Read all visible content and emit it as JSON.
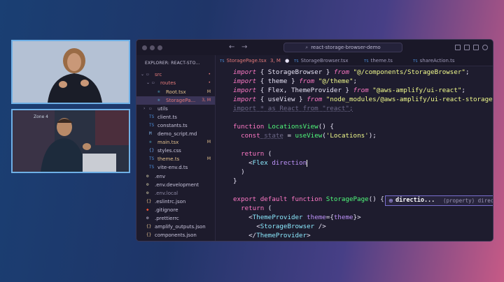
{
  "webcams": {
    "top_label": "",
    "bottom_label": "Zone 4"
  },
  "window": {
    "search_text": "react-storage-browser-demo",
    "back": "←",
    "forward": "→"
  },
  "explorer": {
    "header": "EXPLORER: REACT-STO...",
    "items": [
      {
        "label": "src",
        "icon": "folder-icon",
        "chev": "⌄",
        "badge": "•",
        "color": "#e37979"
      },
      {
        "label": "routes",
        "icon": "folder-icon",
        "chev": "⌄",
        "badge": "•",
        "color": "#e37979"
      },
      {
        "label": "Root.tsx",
        "icon": "tsx-file-icon",
        "badge": "M",
        "color": "#e2c08d"
      },
      {
        "label": "StoragePa...",
        "icon": "tsx-file-icon",
        "badge": "3, M",
        "color": "#e37979"
      },
      {
        "label": "utils",
        "icon": "folder-icon",
        "chev": "›",
        "badge": "",
        "color": "#c9c5dc"
      },
      {
        "label": "client.ts",
        "icon": "ts-file-icon",
        "badge": "",
        "color": "#c9c5dc"
      },
      {
        "label": "constants.ts",
        "icon": "ts-file-icon",
        "badge": "",
        "color": "#c9c5dc"
      },
      {
        "label": "demo_script.md",
        "icon": "md-file-icon",
        "badge": "",
        "color": "#c9c5dc"
      },
      {
        "label": "main.tsx",
        "icon": "tsx-file-icon",
        "badge": "M",
        "color": "#e2c08d"
      },
      {
        "label": "styles.css",
        "icon": "css-file-icon",
        "badge": "",
        "color": "#c9c5dc"
      },
      {
        "label": "theme.ts",
        "icon": "ts-file-icon",
        "badge": "M",
        "color": "#e2c08d"
      },
      {
        "label": "vite-env.d.ts",
        "icon": "ts-file-icon",
        "badge": "",
        "color": "#c9c5dc"
      },
      {
        "label": ".env",
        "icon": "env-file-icon",
        "badge": "",
        "color": "#c9c5dc"
      },
      {
        "label": ".env.development",
        "icon": "env-file-icon",
        "badge": "",
        "color": "#c9c5dc"
      },
      {
        "label": ".env.local",
        "icon": "env-file-icon",
        "badge": "",
        "color": "#8e8aa6"
      },
      {
        "label": ".eslintrc.json",
        "icon": "json-file-icon",
        "badge": "",
        "color": "#c9c5dc"
      },
      {
        "label": ".gitignore",
        "icon": "git-file-icon",
        "badge": "",
        "color": "#c9c5dc"
      },
      {
        "label": ".prettierrc",
        "icon": "config-file-icon",
        "badge": "",
        "color": "#c9c5dc"
      },
      {
        "label": "amplify_outputs.json",
        "icon": "json-file-icon",
        "badge": "",
        "color": "#c9c5dc"
      },
      {
        "label": "components.json",
        "icon": "json-file-icon",
        "badge": "",
        "color": "#c9c5dc"
      }
    ]
  },
  "tabs": [
    {
      "label": "StoragePage.tsx",
      "extra": "3, M",
      "marker": "●"
    },
    {
      "label": "StorageBrowser.tsx",
      "extra": "",
      "marker": ""
    },
    {
      "label": "theme.ts",
      "extra": "",
      "marker": ""
    },
    {
      "label": "shareAction.ts",
      "extra": "",
      "marker": ""
    }
  ],
  "code": {
    "l1": {
      "a": "import",
      "b": " { StorageBrowser } ",
      "c": "from",
      "d": " \"@/components/StorageBrowser\"",
      "e": ";"
    },
    "l2": {
      "a": "import",
      "b": " { theme } ",
      "c": "from",
      "d": " \"@/theme\"",
      "e": ";"
    },
    "l3": {
      "a": "import",
      "b": " { Flex, ThemeProvider } ",
      "c": "from",
      "d": " \"@aws-amplify/ui-react\"",
      "e": ";"
    },
    "l4": {
      "a": "import",
      "b": " { useView } ",
      "c": "from",
      "d": " \"node_modules/@aws-amplify/ui-react-storage/d",
      "e": ""
    },
    "l5": "import * as React from \"react\";",
    "l6": {
      "a": "function",
      "b": " LocationsView",
      "c": "() {"
    },
    "l7": {
      "a": "  const",
      "b": " state",
      "c": " = ",
      "d": "useView",
      "e": "(",
      "f": "'Locations'",
      "g": ");"
    },
    "l8": {
      "a": "  return",
      "b": " ("
    },
    "l9": {
      "a": "    <",
      "b": "Flex",
      "c": " direction"
    },
    "l10": "  )",
    "l11": "}",
    "l12": {
      "a": "export",
      "b": " default",
      "c": " function",
      "d": " StoragePage",
      "e": "() {"
    },
    "l13": {
      "a": "  return",
      "b": " ("
    },
    "l14": {
      "a": "    <",
      "b": "ThemeProvider",
      "c": " theme",
      "d": "={",
      "e": "theme",
      "f": "}>"
    },
    "l15": {
      "a": "      <",
      "b": "StorageBrowser",
      "c": " />"
    },
    "l16": {
      "a": "    </",
      "b": "ThemeProvider",
      "c": ">"
    }
  },
  "suggestion": {
    "icon": "⊕",
    "name": "directio...",
    "detail": "(property) direction?: Responsi..."
  },
  "colors": {
    "accent": "#7a6fd0",
    "modified": "#e2c08d",
    "error": "#e37979"
  }
}
